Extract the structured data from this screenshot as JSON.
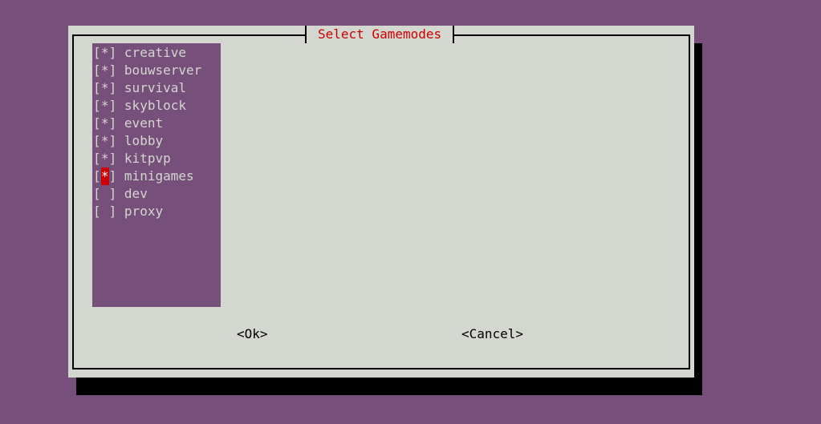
{
  "dialog": {
    "title": "Select Gamemodes",
    "items": [
      {
        "label": "creative",
        "checked": true,
        "mark": "*"
      },
      {
        "label": "bouwserver",
        "checked": true,
        "mark": "*"
      },
      {
        "label": "survival",
        "checked": true,
        "mark": "*"
      },
      {
        "label": "skyblock",
        "checked": true,
        "mark": "*"
      },
      {
        "label": "event",
        "checked": true,
        "mark": "*"
      },
      {
        "label": "lobby",
        "checked": true,
        "mark": "*"
      },
      {
        "label": "kitpvp",
        "checked": true,
        "mark": "*"
      },
      {
        "label": "minigames",
        "checked": true,
        "mark": "*",
        "focused": true
      },
      {
        "label": "dev",
        "checked": false,
        "mark": " "
      },
      {
        "label": "proxy",
        "checked": false,
        "mark": " "
      }
    ],
    "ok_label": "<Ok>",
    "cancel_label": "<Cancel>"
  },
  "colors": {
    "background": "#774f7b",
    "dialog": "#d3d7cf",
    "title": "#cc0000",
    "focus": "#cc0000"
  }
}
